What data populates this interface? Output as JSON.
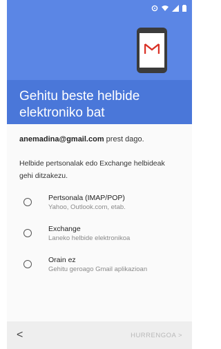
{
  "status_icons": [
    "alarm-icon",
    "wifi-icon",
    "signal-icon",
    "battery-icon"
  ],
  "colors": {
    "header": "#5b86e5",
    "title_band": "#4a77d9",
    "gmail_red": "#d93025"
  },
  "header": {
    "title": "Gehitu beste helbide elektroniko bat"
  },
  "main": {
    "email": "anemadina@gmail.com",
    "email_suffix": " prest dago.",
    "description": "Helbide pertsonalak edo Exchange helbideak gehi ditzakezu.",
    "options": [
      {
        "title": "Pertsonala (IMAP/POP)",
        "subtitle": "Yahoo, Outlook.com, etab."
      },
      {
        "title": "Exchange",
        "subtitle": "Laneko helbide elektronikoa"
      },
      {
        "title": "Orain ez",
        "subtitle": "Gehitu geroago Gmail aplikazioan"
      }
    ]
  },
  "footer": {
    "back_icon": "chevron-left-icon",
    "back_label": "<",
    "next_label": "HURRENGOA >"
  }
}
